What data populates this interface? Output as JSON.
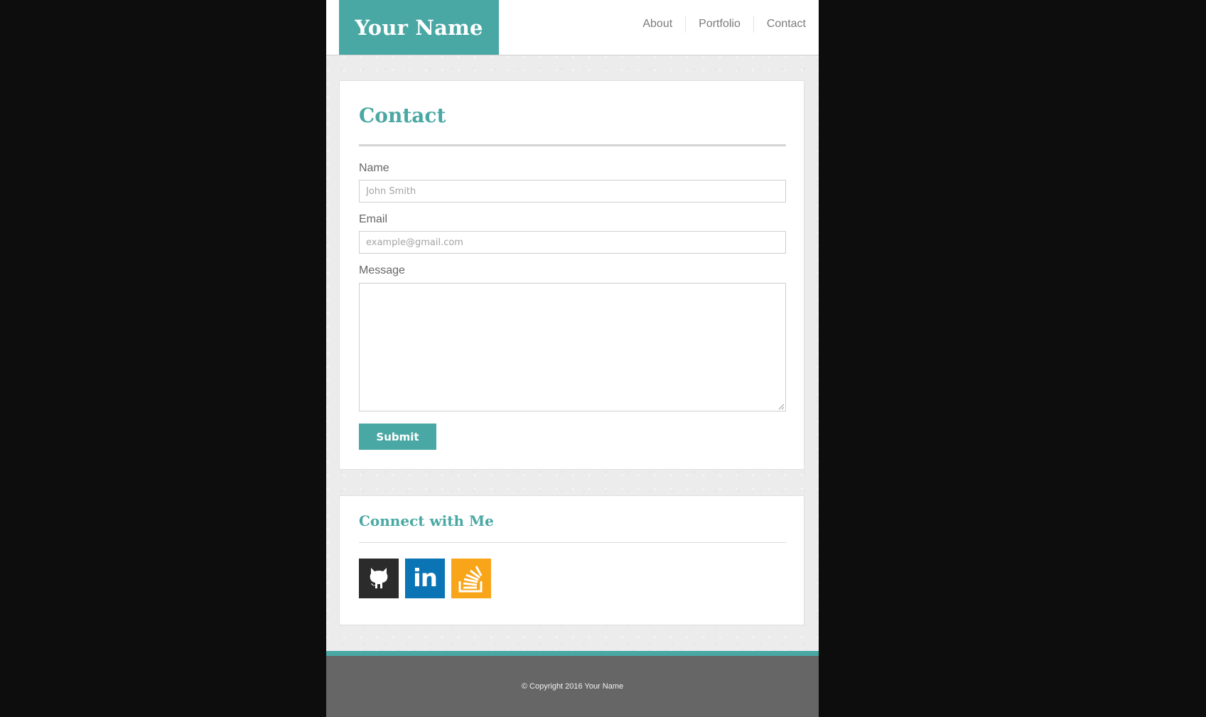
{
  "header": {
    "brand": "Your Name",
    "nav": [
      "About",
      "Portfolio",
      "Contact"
    ]
  },
  "contact": {
    "title": "Contact",
    "name_label": "Name",
    "name_placeholder": "John Smith",
    "email_label": "Email",
    "email_placeholder": "example@gmail.com",
    "message_label": "Message",
    "submit_label": "Submit"
  },
  "connect": {
    "title": "Connect with Me",
    "icons": [
      "github-icon",
      "linkedin-icon",
      "stackoverflow-icon"
    ],
    "linkedin_text": "in"
  },
  "footer": {
    "copyright": "© Copyright 2016 Your Name"
  },
  "colors": {
    "accent": "#4aa8a4",
    "github": "#2b2b2b",
    "linkedin": "#0a74b4",
    "stackoverflow": "#f9a51a",
    "footer": "#666666"
  }
}
